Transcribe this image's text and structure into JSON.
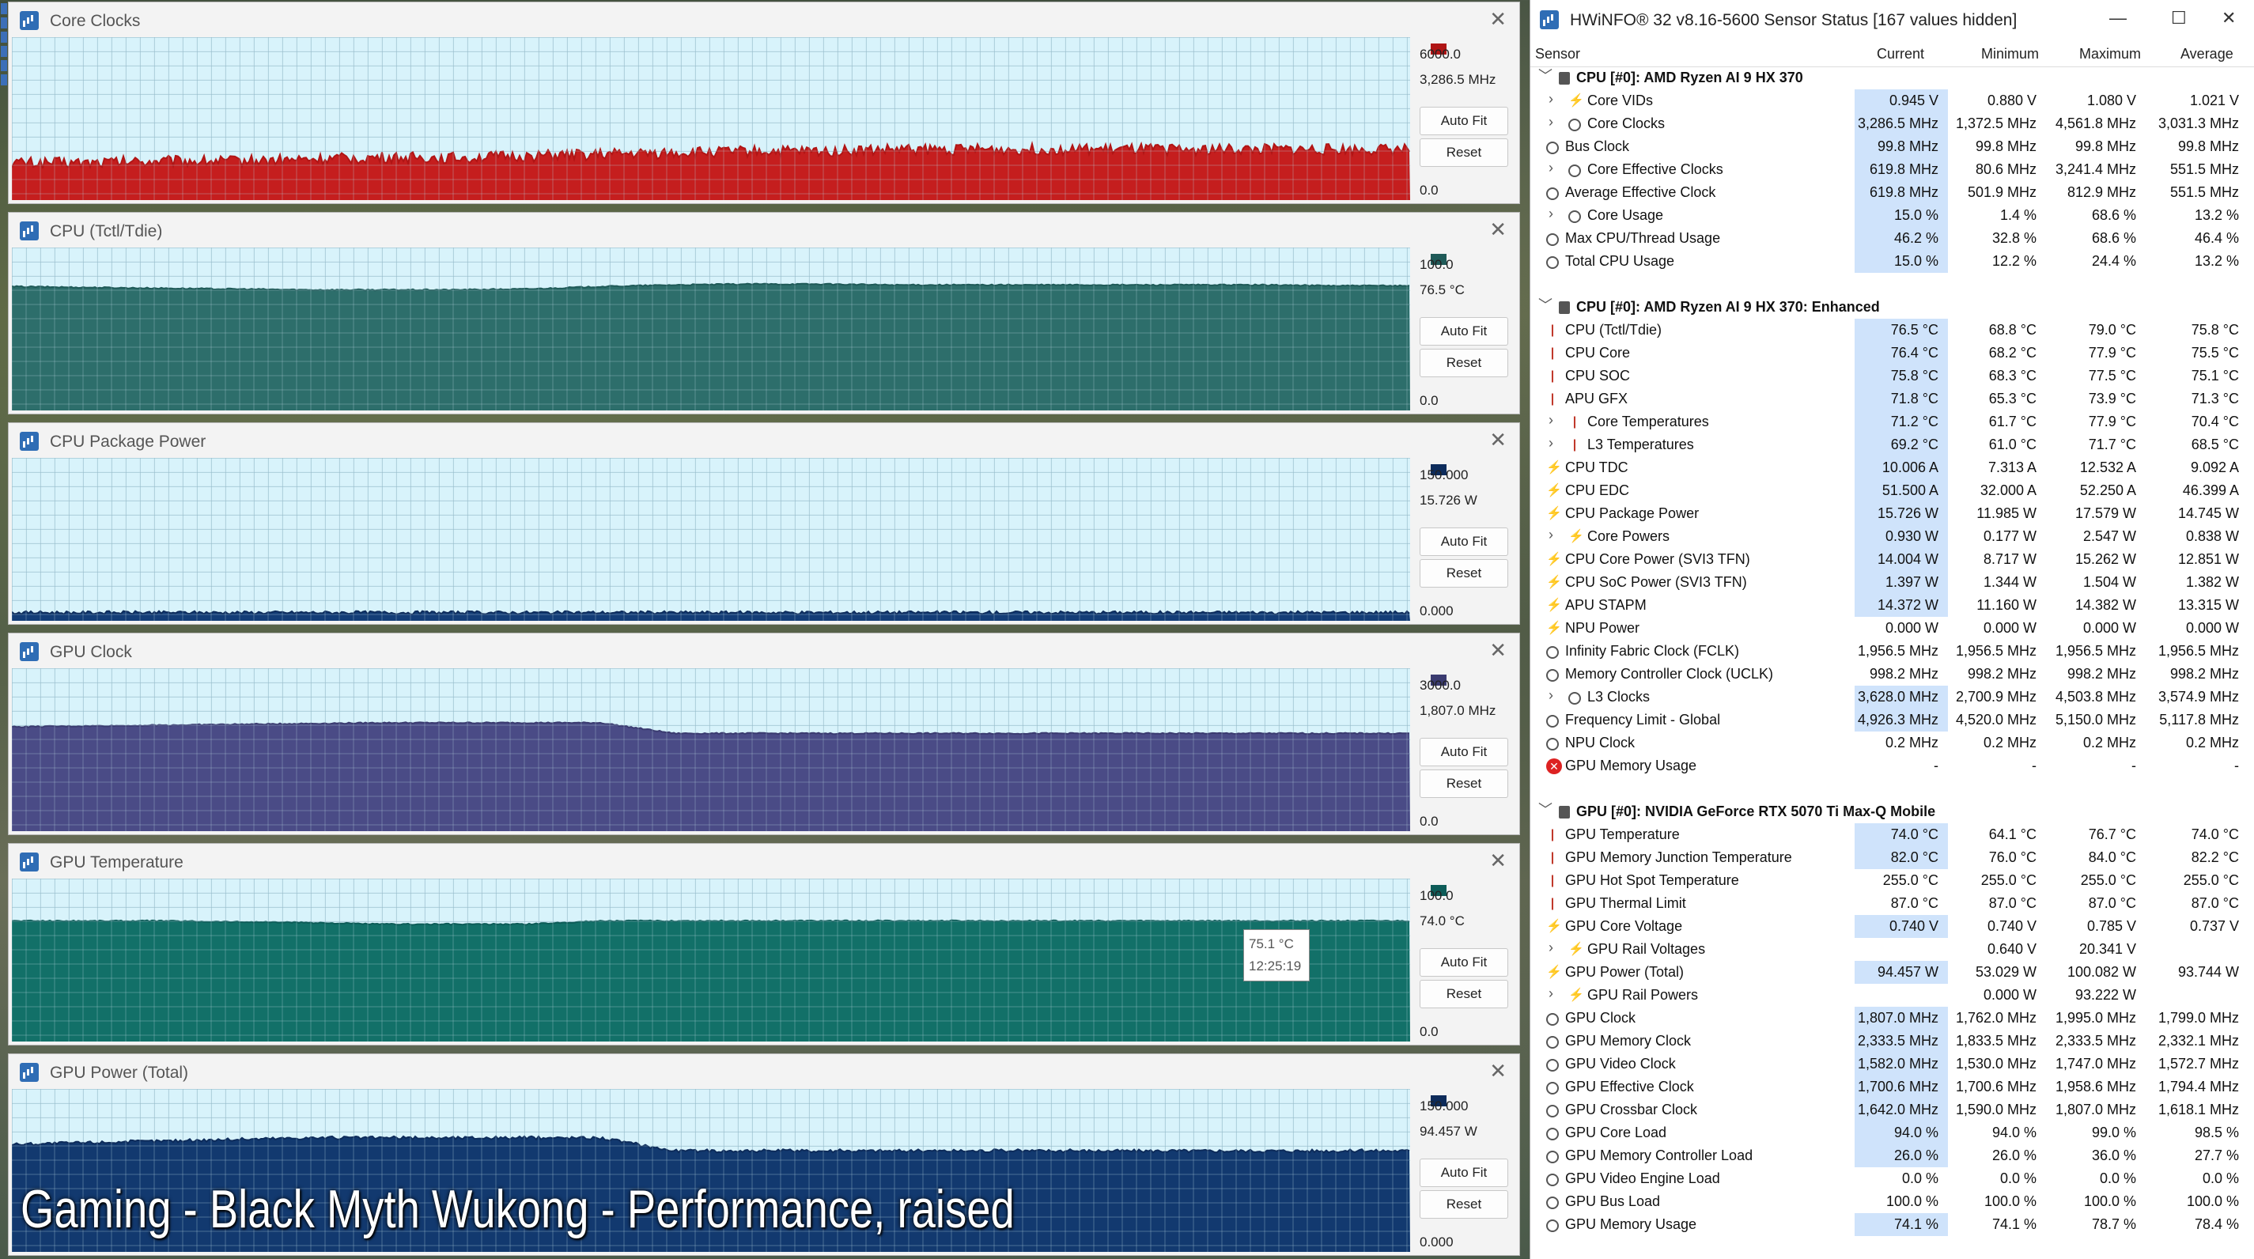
{
  "caption": "Gaming - Black Myth Wukong - Performance, raised",
  "graphs": [
    {
      "title": "Core Clocks",
      "max": "6000.0",
      "current": "3,286.5 MHz",
      "min": "0.0",
      "auto_fit": "Auto Fit",
      "reset": "Reset",
      "color": "#b01515",
      "fill": "#c51e1e",
      "profile": [
        0.23,
        0.23,
        0.24,
        0.24,
        0.25,
        0.26,
        0.26,
        0.27,
        0.28,
        0.29,
        0.3,
        0.3,
        0.31,
        0.31,
        0.31,
        0.31,
        0.31,
        0.31,
        0.31,
        0.31
      ],
      "noise": 0.035
    },
    {
      "title": "CPU (Tctl/Tdie)",
      "max": "100.0",
      "current": "76.5 °C",
      "min": "0.0",
      "auto_fit": "Auto Fit",
      "reset": "Reset",
      "color": "#1f5a58",
      "fill": "#2d6e6b",
      "profile": [
        0.76,
        0.755,
        0.75,
        0.745,
        0.74,
        0.74,
        0.74,
        0.745,
        0.76,
        0.77,
        0.775,
        0.775,
        0.77,
        0.77,
        0.77,
        0.77,
        0.77,
        0.77,
        0.765,
        0.765
      ],
      "noise": 0.004
    },
    {
      "title": "CPU Package Power",
      "max": "150.000",
      "current": "15.726 W",
      "min": "0.000",
      "auto_fit": "Auto Fit",
      "reset": "Reset",
      "color": "#0d2c5c",
      "fill": "#133d77",
      "profile": [
        0.05,
        0.05,
        0.05,
        0.05,
        0.05,
        0.05,
        0.05,
        0.05,
        0.05,
        0.05,
        0.05,
        0.05,
        0.05,
        0.05,
        0.05,
        0.05,
        0.05,
        0.05,
        0.05,
        0.05
      ],
      "noise": 0.01
    },
    {
      "title": "GPU Clock",
      "max": "3000.0",
      "current": "1,807.0 MHz",
      "min": "0.0",
      "auto_fit": "Auto Fit",
      "reset": "Reset",
      "color": "#3a3b70",
      "fill": "#4a4b86",
      "profile": [
        0.64,
        0.645,
        0.65,
        0.655,
        0.66,
        0.665,
        0.665,
        0.665,
        0.665,
        0.6,
        0.6,
        0.6,
        0.6,
        0.6,
        0.6,
        0.6,
        0.6,
        0.6,
        0.6,
        0.6
      ],
      "noise": 0.004
    },
    {
      "title": "GPU Temperature",
      "max": "100.0",
      "current": "74.0 °C",
      "min": "0.0",
      "auto_fit": "Auto Fit",
      "reset": "Reset",
      "color": "#0d5c58",
      "fill": "#127068",
      "profile": [
        0.74,
        0.74,
        0.74,
        0.735,
        0.73,
        0.72,
        0.72,
        0.72,
        0.74,
        0.74,
        0.74,
        0.74,
        0.74,
        0.74,
        0.74,
        0.74,
        0.74,
        0.74,
        0.74,
        0.74
      ],
      "noise": 0.004
    },
    {
      "title": "GPU Power (Total)",
      "max": "150.000",
      "current": "94.457 W",
      "min": "0.000",
      "auto_fit": "Auto Fit",
      "reset": "Reset",
      "color": "#0d2b5a",
      "fill": "#12396f",
      "profile": [
        0.66,
        0.67,
        0.68,
        0.69,
        0.7,
        0.7,
        0.7,
        0.7,
        0.7,
        0.62,
        0.62,
        0.62,
        0.62,
        0.62,
        0.62,
        0.62,
        0.62,
        0.62,
        0.62,
        0.62
      ],
      "noise": 0.01
    }
  ],
  "tooltip": {
    "value": "75.1 °C",
    "time": "12:25:19"
  },
  "hwinfo": {
    "title": "HWiNFO® 32 v8.16-5600 Sensor Status [167 values hidden]",
    "minimize": "—",
    "maximize": "☐",
    "close": "✕",
    "columns": {
      "sensor": "Sensor",
      "current": "Current",
      "minimum": "Minimum",
      "maximum": "Maximum",
      "average": "Average"
    },
    "rows": [
      {
        "type": "group",
        "label": "CPU [#0]: AMD Ryzen AI 9 HX 370"
      },
      {
        "icon": "bolt",
        "expand": true,
        "label": "Core VIDs",
        "cur": "0.945 V",
        "min": "0.880 V",
        "max": "1.080 V",
        "avg": "1.021 V",
        "hl": true
      },
      {
        "icon": "clock",
        "expand": true,
        "label": "Core Clocks",
        "cur": "3,286.5 MHz",
        "min": "1,372.5 MHz",
        "max": "4,561.8 MHz",
        "avg": "3,031.3 MHz",
        "hl": true
      },
      {
        "icon": "clock",
        "label": "Bus Clock",
        "cur": "99.8 MHz",
        "min": "99.8 MHz",
        "max": "99.8 MHz",
        "avg": "99.8 MHz",
        "hl": true
      },
      {
        "icon": "clock",
        "expand": true,
        "label": "Core Effective Clocks",
        "cur": "619.8 MHz",
        "min": "80.6 MHz",
        "max": "3,241.4 MHz",
        "avg": "551.5 MHz",
        "hl": true
      },
      {
        "icon": "clock",
        "label": "Average Effective Clock",
        "cur": "619.8 MHz",
        "min": "501.9 MHz",
        "max": "812.9 MHz",
        "avg": "551.5 MHz",
        "hl": true
      },
      {
        "icon": "pct",
        "expand": true,
        "label": "Core Usage",
        "cur": "15.0 %",
        "min": "1.4 %",
        "max": "68.6 %",
        "avg": "13.2 %",
        "hl": true
      },
      {
        "icon": "pct",
        "label": "Max CPU/Thread Usage",
        "cur": "46.2 %",
        "min": "32.8 %",
        "max": "68.6 %",
        "avg": "46.4 %",
        "hl": true
      },
      {
        "icon": "pct",
        "label": "Total CPU Usage",
        "cur": "15.0 %",
        "min": "12.2 %",
        "max": "24.4 %",
        "avg": "13.2 %",
        "hl": true
      },
      {
        "type": "spacer"
      },
      {
        "type": "group",
        "label": "CPU [#0]: AMD Ryzen AI 9 HX 370: Enhanced"
      },
      {
        "icon": "therm",
        "label": "CPU (Tctl/Tdie)",
        "cur": "76.5 °C",
        "min": "68.8 °C",
        "max": "79.0 °C",
        "avg": "75.8 °C",
        "hl": true
      },
      {
        "icon": "therm",
        "label": "CPU Core",
        "cur": "76.4 °C",
        "min": "68.2 °C",
        "max": "77.9 °C",
        "avg": "75.5 °C",
        "hl": true
      },
      {
        "icon": "therm",
        "label": "CPU SOC",
        "cur": "75.8 °C",
        "min": "68.3 °C",
        "max": "77.5 °C",
        "avg": "75.1 °C",
        "hl": true
      },
      {
        "icon": "therm",
        "label": "APU GFX",
        "cur": "71.8 °C",
        "min": "65.3 °C",
        "max": "73.9 °C",
        "avg": "71.3 °C",
        "hl": true
      },
      {
        "icon": "therm",
        "expand": true,
        "label": "Core Temperatures",
        "cur": "71.2 °C",
        "min": "61.7 °C",
        "max": "77.9 °C",
        "avg": "70.4 °C",
        "hl": true
      },
      {
        "icon": "therm",
        "expand": true,
        "label": "L3 Temperatures",
        "cur": "69.2 °C",
        "min": "61.0 °C",
        "max": "71.7 °C",
        "avg": "68.5 °C",
        "hl": true
      },
      {
        "icon": "bolt",
        "label": "CPU TDC",
        "cur": "10.006 A",
        "min": "7.313 A",
        "max": "12.532 A",
        "avg": "9.092 A",
        "hl": true
      },
      {
        "icon": "bolt",
        "label": "CPU EDC",
        "cur": "51.500 A",
        "min": "32.000 A",
        "max": "52.250 A",
        "avg": "46.399 A",
        "hl": true
      },
      {
        "icon": "bolt",
        "label": "CPU Package Power",
        "cur": "15.726 W",
        "min": "11.985 W",
        "max": "17.579 W",
        "avg": "14.745 W",
        "hl": true
      },
      {
        "icon": "bolt",
        "expand": true,
        "label": "Core Powers",
        "cur": "0.930 W",
        "min": "0.177 W",
        "max": "2.547 W",
        "avg": "0.838 W",
        "hl": true
      },
      {
        "icon": "bolt",
        "label": "CPU Core Power (SVI3 TFN)",
        "cur": "14.004 W",
        "min": "8.717 W",
        "max": "15.262 W",
        "avg": "12.851 W",
        "hl": true
      },
      {
        "icon": "bolt",
        "label": "CPU SoC Power (SVI3 TFN)",
        "cur": "1.397 W",
        "min": "1.344 W",
        "max": "1.504 W",
        "avg": "1.382 W",
        "hl": true
      },
      {
        "icon": "bolt",
        "label": "APU STAPM",
        "cur": "14.372 W",
        "min": "11.160 W",
        "max": "14.382 W",
        "avg": "13.315 W",
        "hl": true
      },
      {
        "icon": "bolt",
        "label": "NPU Power",
        "cur": "0.000 W",
        "min": "0.000 W",
        "max": "0.000 W",
        "avg": "0.000 W",
        "hl": false
      },
      {
        "icon": "clock",
        "label": "Infinity Fabric Clock (FCLK)",
        "cur": "1,956.5 MHz",
        "min": "1,956.5 MHz",
        "max": "1,956.5 MHz",
        "avg": "1,956.5 MHz",
        "hl": false
      },
      {
        "icon": "clock",
        "label": "Memory Controller Clock (UCLK)",
        "cur": "998.2 MHz",
        "min": "998.2 MHz",
        "max": "998.2 MHz",
        "avg": "998.2 MHz",
        "hl": false
      },
      {
        "icon": "clock",
        "expand": true,
        "label": "L3 Clocks",
        "cur": "3,628.0 MHz",
        "min": "2,700.9 MHz",
        "max": "4,503.8 MHz",
        "avg": "3,574.9 MHz",
        "hl": true
      },
      {
        "icon": "clock",
        "label": "Frequency Limit - Global",
        "cur": "4,926.3 MHz",
        "min": "4,520.0 MHz",
        "max": "5,150.0 MHz",
        "avg": "5,117.8 MHz",
        "hl": true
      },
      {
        "icon": "clock",
        "label": "NPU Clock",
        "cur": "0.2 MHz",
        "min": "0.2 MHz",
        "max": "0.2 MHz",
        "avg": "0.2 MHz",
        "hl": false
      },
      {
        "icon": "err",
        "label": "GPU Memory Usage",
        "cur": "-",
        "min": "-",
        "max": "-",
        "avg": "-",
        "hl": false
      },
      {
        "type": "spacer"
      },
      {
        "type": "group",
        "label": "GPU [#0]: NVIDIA  GeForce RTX 5070 Ti Max-Q Mobile"
      },
      {
        "icon": "therm",
        "label": "GPU Temperature",
        "cur": "74.0 °C",
        "min": "64.1 °C",
        "max": "76.7 °C",
        "avg": "74.0 °C",
        "hl": true
      },
      {
        "icon": "therm",
        "label": "GPU Memory Junction Temperature",
        "cur": "82.0 °C",
        "min": "76.0 °C",
        "max": "84.0 °C",
        "avg": "82.2 °C",
        "hl": true
      },
      {
        "icon": "therm",
        "label": "GPU Hot Spot Temperature",
        "cur": "255.0 °C",
        "min": "255.0 °C",
        "max": "255.0 °C",
        "avg": "255.0 °C",
        "hl": false
      },
      {
        "icon": "therm",
        "label": "GPU Thermal Limit",
        "cur": "87.0 °C",
        "min": "87.0 °C",
        "max": "87.0 °C",
        "avg": "87.0 °C",
        "hl": false
      },
      {
        "icon": "bolt",
        "label": "GPU Core Voltage",
        "cur": "0.740 V",
        "min": "0.740 V",
        "max": "0.785 V",
        "avg": "0.737 V",
        "hl": true
      },
      {
        "icon": "bolt",
        "expand": true,
        "label": "GPU Rail Voltages",
        "cur": "",
        "min": "0.640 V",
        "max": "20.341 V",
        "avg": "",
        "hl": false
      },
      {
        "icon": "bolt",
        "label": "GPU Power (Total)",
        "cur": "94.457 W",
        "min": "53.029 W",
        "max": "100.082 W",
        "avg": "93.744 W",
        "hl": true
      },
      {
        "icon": "bolt",
        "expand": true,
        "label": "GPU Rail Powers",
        "cur": "",
        "min": "0.000 W",
        "max": "93.222 W",
        "avg": "",
        "hl": false
      },
      {
        "icon": "clock",
        "label": "GPU Clock",
        "cur": "1,807.0 MHz",
        "min": "1,762.0 MHz",
        "max": "1,995.0 MHz",
        "avg": "1,799.0 MHz",
        "hl": true
      },
      {
        "icon": "clock",
        "label": "GPU Memory Clock",
        "cur": "2,333.5 MHz",
        "min": "1,833.5 MHz",
        "max": "2,333.5 MHz",
        "avg": "2,332.1 MHz",
        "hl": true
      },
      {
        "icon": "clock",
        "label": "GPU Video Clock",
        "cur": "1,582.0 MHz",
        "min": "1,530.0 MHz",
        "max": "1,747.0 MHz",
        "avg": "1,572.7 MHz",
        "hl": true
      },
      {
        "icon": "clock",
        "label": "GPU Effective Clock",
        "cur": "1,700.6 MHz",
        "min": "1,700.6 MHz",
        "max": "1,958.6 MHz",
        "avg": "1,794.4 MHz",
        "hl": true
      },
      {
        "icon": "clock",
        "label": "GPU Crossbar Clock",
        "cur": "1,642.0 MHz",
        "min": "1,590.0 MHz",
        "max": "1,807.0 MHz",
        "avg": "1,618.1 MHz",
        "hl": true
      },
      {
        "icon": "pct",
        "label": "GPU Core Load",
        "cur": "94.0 %",
        "min": "94.0 %",
        "max": "99.0 %",
        "avg": "98.5 %",
        "hl": true
      },
      {
        "icon": "pct",
        "label": "GPU Memory Controller Load",
        "cur": "26.0 %",
        "min": "26.0 %",
        "max": "36.0 %",
        "avg": "27.7 %",
        "hl": true
      },
      {
        "icon": "pct",
        "label": "GPU Video Engine Load",
        "cur": "0.0 %",
        "min": "0.0 %",
        "max": "0.0 %",
        "avg": "0.0 %",
        "hl": false
      },
      {
        "icon": "pct",
        "label": "GPU Bus Load",
        "cur": "100.0 %",
        "min": "100.0 %",
        "max": "100.0 %",
        "avg": "100.0 %",
        "hl": false
      },
      {
        "icon": "pct",
        "label": "GPU Memory Usage",
        "cur": "74.1 %",
        "min": "74.1 %",
        "max": "78.7 %",
        "avg": "78.4 %",
        "hl": true
      }
    ]
  }
}
